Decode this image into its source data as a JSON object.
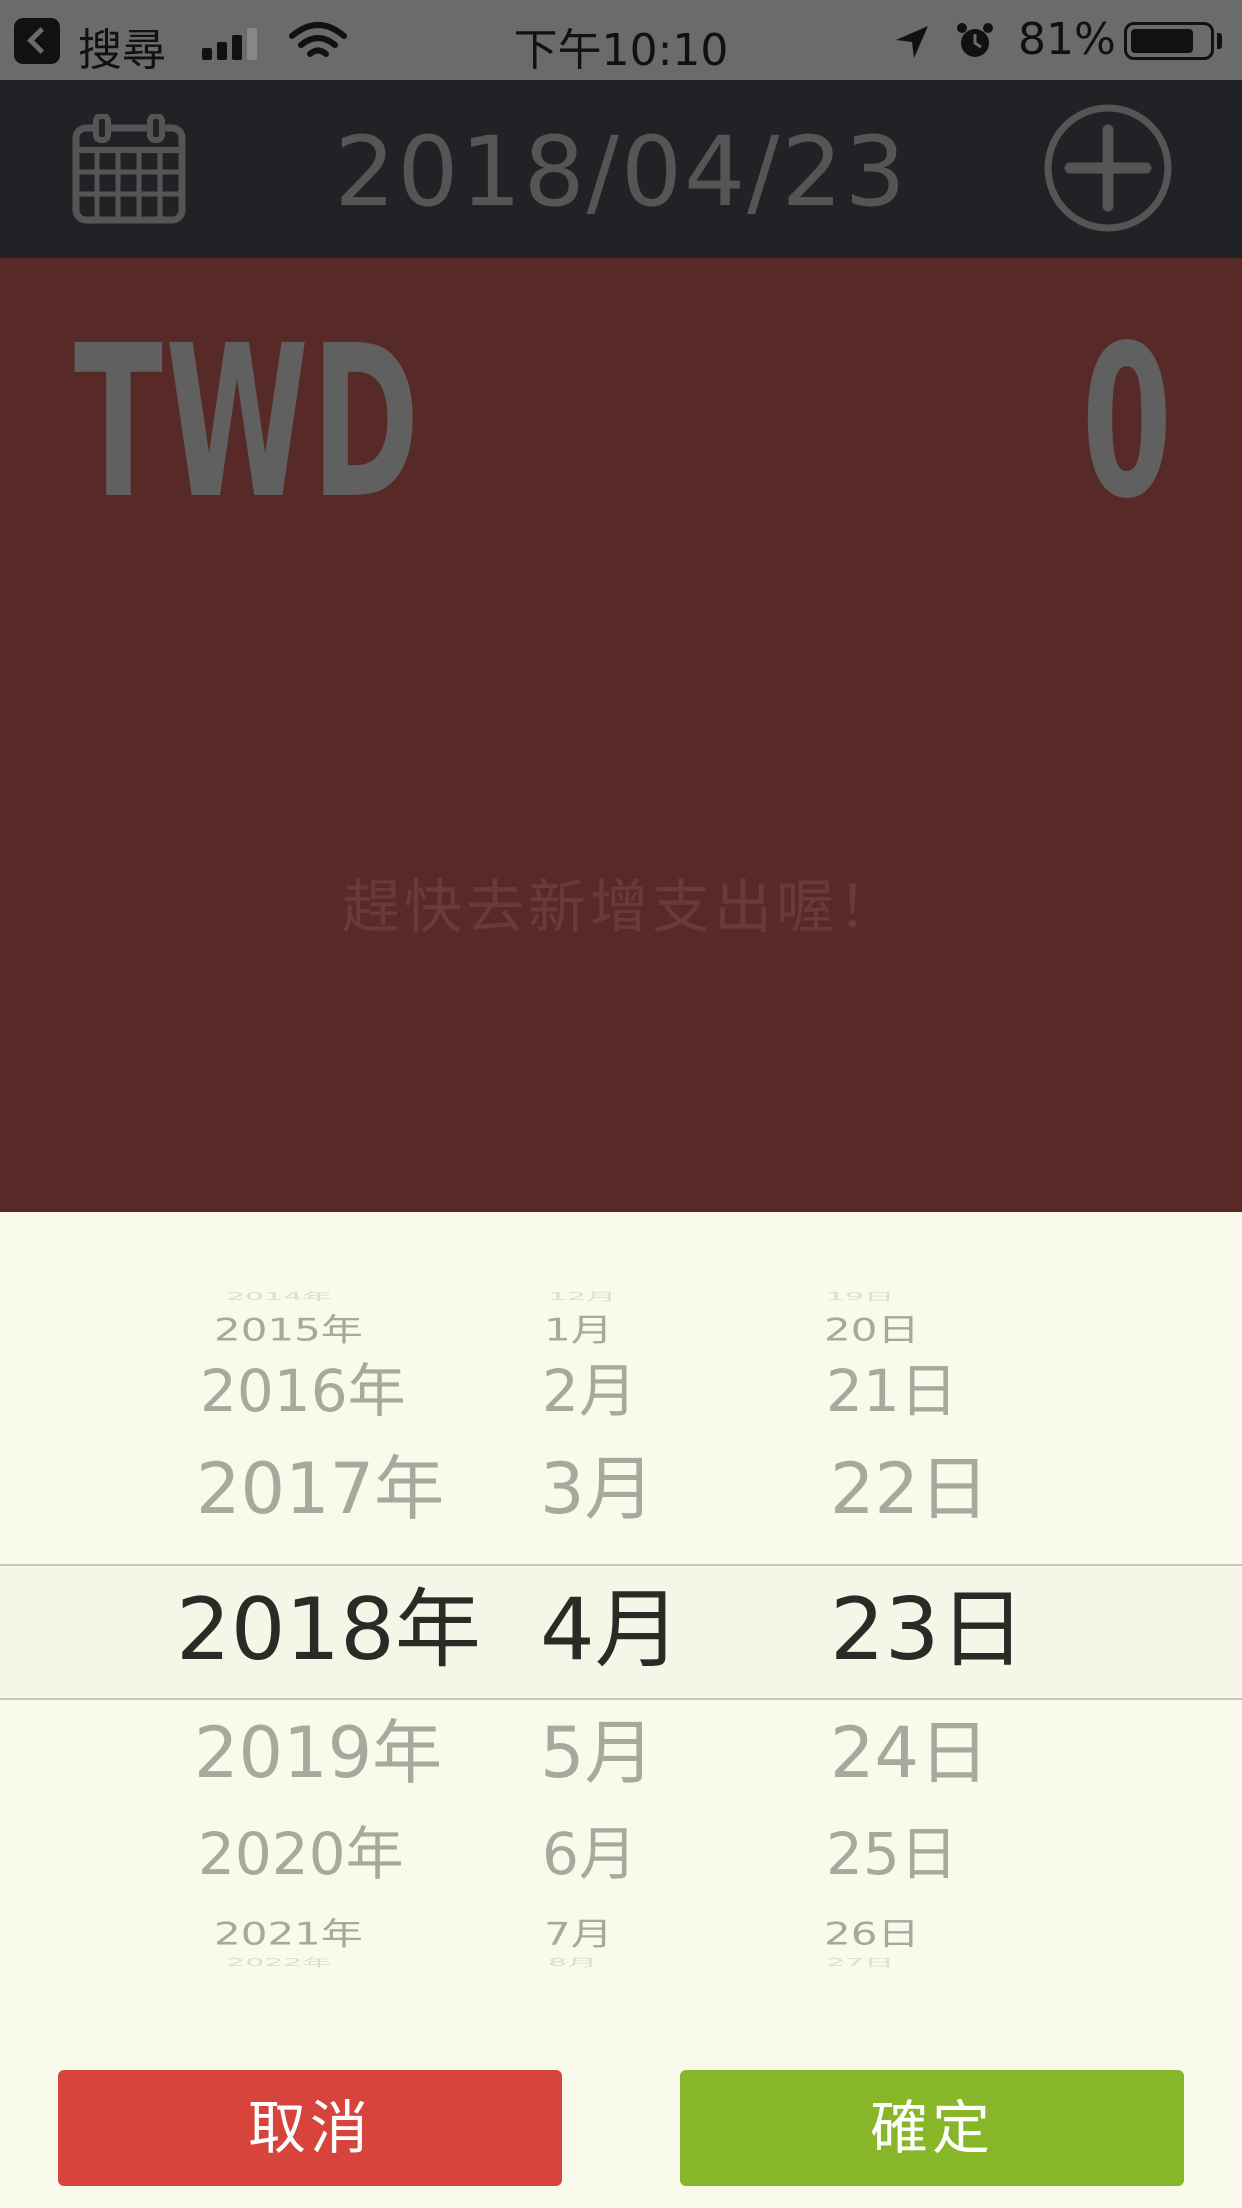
{
  "status_bar": {
    "back_label": "搜尋",
    "time": "下午10:10",
    "battery_percent": "81%",
    "battery_level": 0.81,
    "icons": [
      "signal-icon",
      "wifi-icon",
      "location-arrow-icon",
      "alarm-icon",
      "battery-icon"
    ]
  },
  "header": {
    "date": "2018/04/23",
    "calendar_icon": "calendar-icon",
    "add_icon": "plus-circle-icon"
  },
  "summary": {
    "currency": "TWD",
    "amount": "0",
    "empty_message": "趕快去新增支出喔！"
  },
  "picker": {
    "years": [
      "2014年",
      "2015年",
      "2016年",
      "2017年",
      "2018年",
      "2019年",
      "2020年",
      "2021年",
      "2022年"
    ],
    "months": [
      "12月",
      "1月",
      "2月",
      "3月",
      "4月",
      "5月",
      "6月",
      "7月",
      "8月"
    ],
    "days": [
      "19日",
      "20日",
      "21日",
      "22日",
      "23日",
      "24日",
      "25日",
      "26日",
      "27日"
    ],
    "selected": {
      "year": "2018年",
      "month": "4月",
      "day": "23日"
    }
  },
  "buttons": {
    "cancel": "取消",
    "confirm": "確定"
  },
  "colors": {
    "header_bg": "#222226",
    "main_bg": "#572a28",
    "sheet_bg": "#f9f9ec",
    "cancel_bg": "#d6443c",
    "confirm_bg": "#87b729"
  }
}
